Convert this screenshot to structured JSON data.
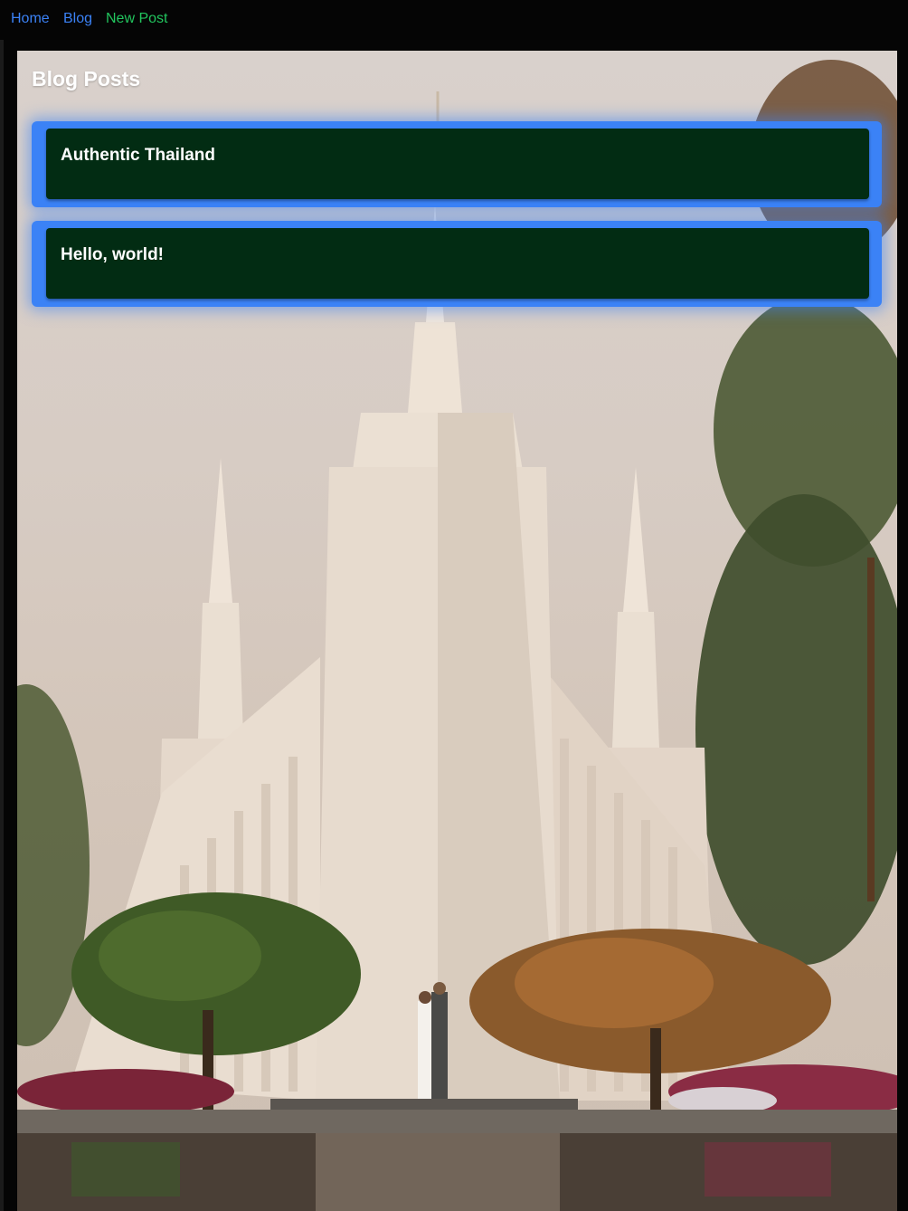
{
  "nav": {
    "home": "Home",
    "blog": "Blog",
    "new_post": "New Post"
  },
  "main": {
    "title": "Blog Posts",
    "posts": [
      {
        "title": "Authentic Thailand"
      },
      {
        "title": "Hello, world!"
      }
    ]
  },
  "colors": {
    "nav_link": "#3b82f6",
    "nav_active": "#22c55e",
    "post_shell": "#3b82f6",
    "post_card": "#022c13"
  }
}
